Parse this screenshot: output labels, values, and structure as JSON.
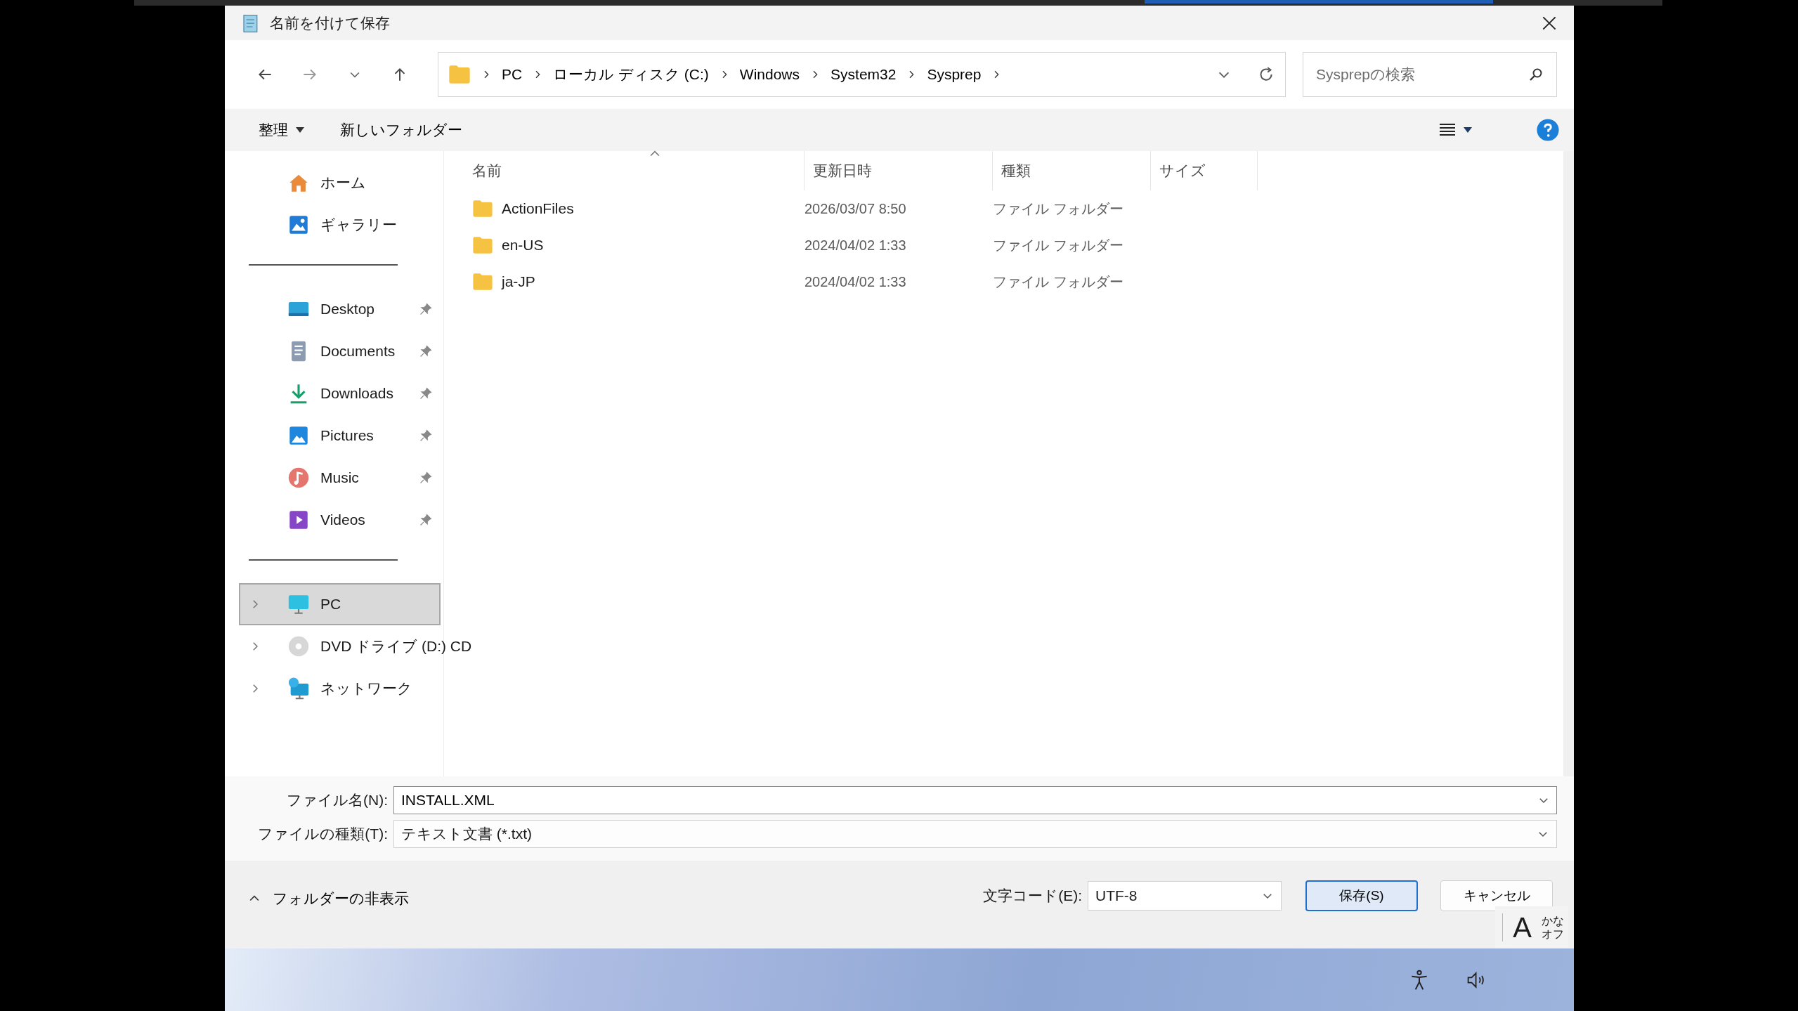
{
  "window": {
    "title": "名前を付けて保存"
  },
  "address_bar": {
    "crumbs": [
      "PC",
      "ローカル ディスク (C:)",
      "Windows",
      "System32",
      "Sysprep"
    ]
  },
  "search": {
    "placeholder": "Sysprepの検索"
  },
  "toolbar": {
    "organize": "整理",
    "new_folder": "新しいフォルダー"
  },
  "sidebar": {
    "groups": [
      {
        "items": [
          {
            "label": "ホーム",
            "kind": "home",
            "pinned": false,
            "expandable": false,
            "selected": false
          },
          {
            "label": "ギャラリー",
            "kind": "gallery",
            "pinned": false,
            "expandable": false,
            "selected": false
          }
        ]
      },
      {
        "items": [
          {
            "label": "Desktop",
            "kind": "desktop",
            "pinned": true,
            "expandable": false,
            "selected": false
          },
          {
            "label": "Documents",
            "kind": "documents",
            "pinned": true,
            "expandable": false,
            "selected": false
          },
          {
            "label": "Downloads",
            "kind": "downloads",
            "pinned": true,
            "expandable": false,
            "selected": false
          },
          {
            "label": "Pictures",
            "kind": "pictures",
            "pinned": true,
            "expandable": false,
            "selected": false
          },
          {
            "label": "Music",
            "kind": "music",
            "pinned": true,
            "expandable": false,
            "selected": false
          },
          {
            "label": "Videos",
            "kind": "videos",
            "pinned": true,
            "expandable": false,
            "selected": false
          }
        ]
      },
      {
        "items": [
          {
            "label": "PC",
            "kind": "pc",
            "pinned": false,
            "expandable": true,
            "selected": true
          },
          {
            "label": "DVD ドライブ (D:) CD",
            "kind": "dvd",
            "pinned": false,
            "expandable": true,
            "selected": false
          },
          {
            "label": "ネットワーク",
            "kind": "network",
            "pinned": false,
            "expandable": true,
            "selected": false
          }
        ]
      }
    ]
  },
  "table": {
    "columns": [
      {
        "label": "名前",
        "sorted": true
      },
      {
        "label": "更新日時",
        "sorted": false
      },
      {
        "label": "種類",
        "sorted": false
      },
      {
        "label": "サイズ",
        "sorted": false
      }
    ],
    "rows": [
      {
        "name": "ActionFiles",
        "modified": "2026/03/07 8:50",
        "type": "ファイル フォルダー"
      },
      {
        "name": "en-US",
        "modified": "2024/04/02 1:33",
        "type": "ファイル フォルダー"
      },
      {
        "name": "ja-JP",
        "modified": "2024/04/02 1:33",
        "type": "ファイル フォルダー"
      }
    ]
  },
  "file_name": {
    "label": "ファイル名(N):",
    "value": "INSTALL.XML"
  },
  "file_type": {
    "label": "ファイルの種類(T):",
    "value": "テキスト文書 (*.txt)"
  },
  "hide_folders": "フォルダーの非表示",
  "encoding": {
    "label": "文字コード(E):",
    "value": "UTF-8"
  },
  "buttons": [
    {
      "label": "保存(S)",
      "default": true
    },
    {
      "label": "キャンセル",
      "default": false
    }
  ],
  "ime": {
    "mode": "A",
    "labels": [
      "かな",
      "オフ"
    ]
  }
}
